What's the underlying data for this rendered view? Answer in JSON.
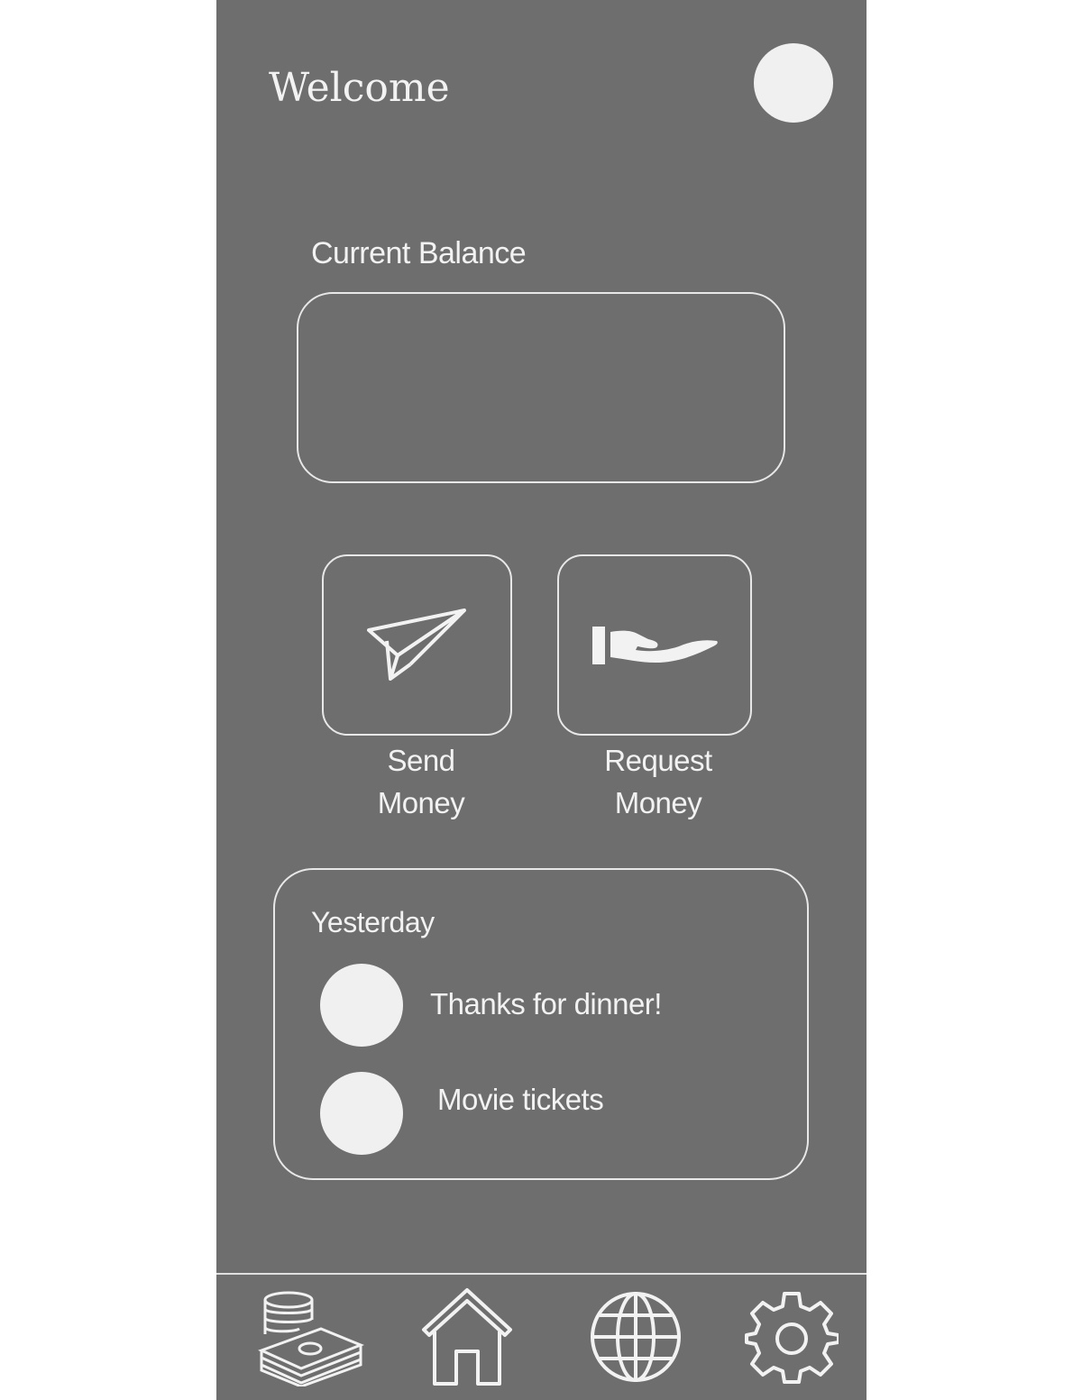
{
  "header": {
    "welcome": "Welcome"
  },
  "balance": {
    "label": "Current Balance"
  },
  "actions": {
    "send": {
      "line1": "Send",
      "line2": "Money",
      "icon": "paper-plane-icon"
    },
    "request": {
      "line1": "Request",
      "line2": "Money",
      "icon": "open-hand-icon"
    }
  },
  "activity": {
    "heading": "Yesterday",
    "items": [
      {
        "text": "Thanks for dinner!"
      },
      {
        "text": "Movie tickets"
      }
    ]
  },
  "nav": [
    {
      "icon": "money-stack-icon"
    },
    {
      "icon": "home-icon"
    },
    {
      "icon": "globe-icon"
    },
    {
      "icon": "gear-icon"
    }
  ],
  "colors": {
    "background": "#6e6e6e",
    "foreground": "#f2f2f2"
  }
}
